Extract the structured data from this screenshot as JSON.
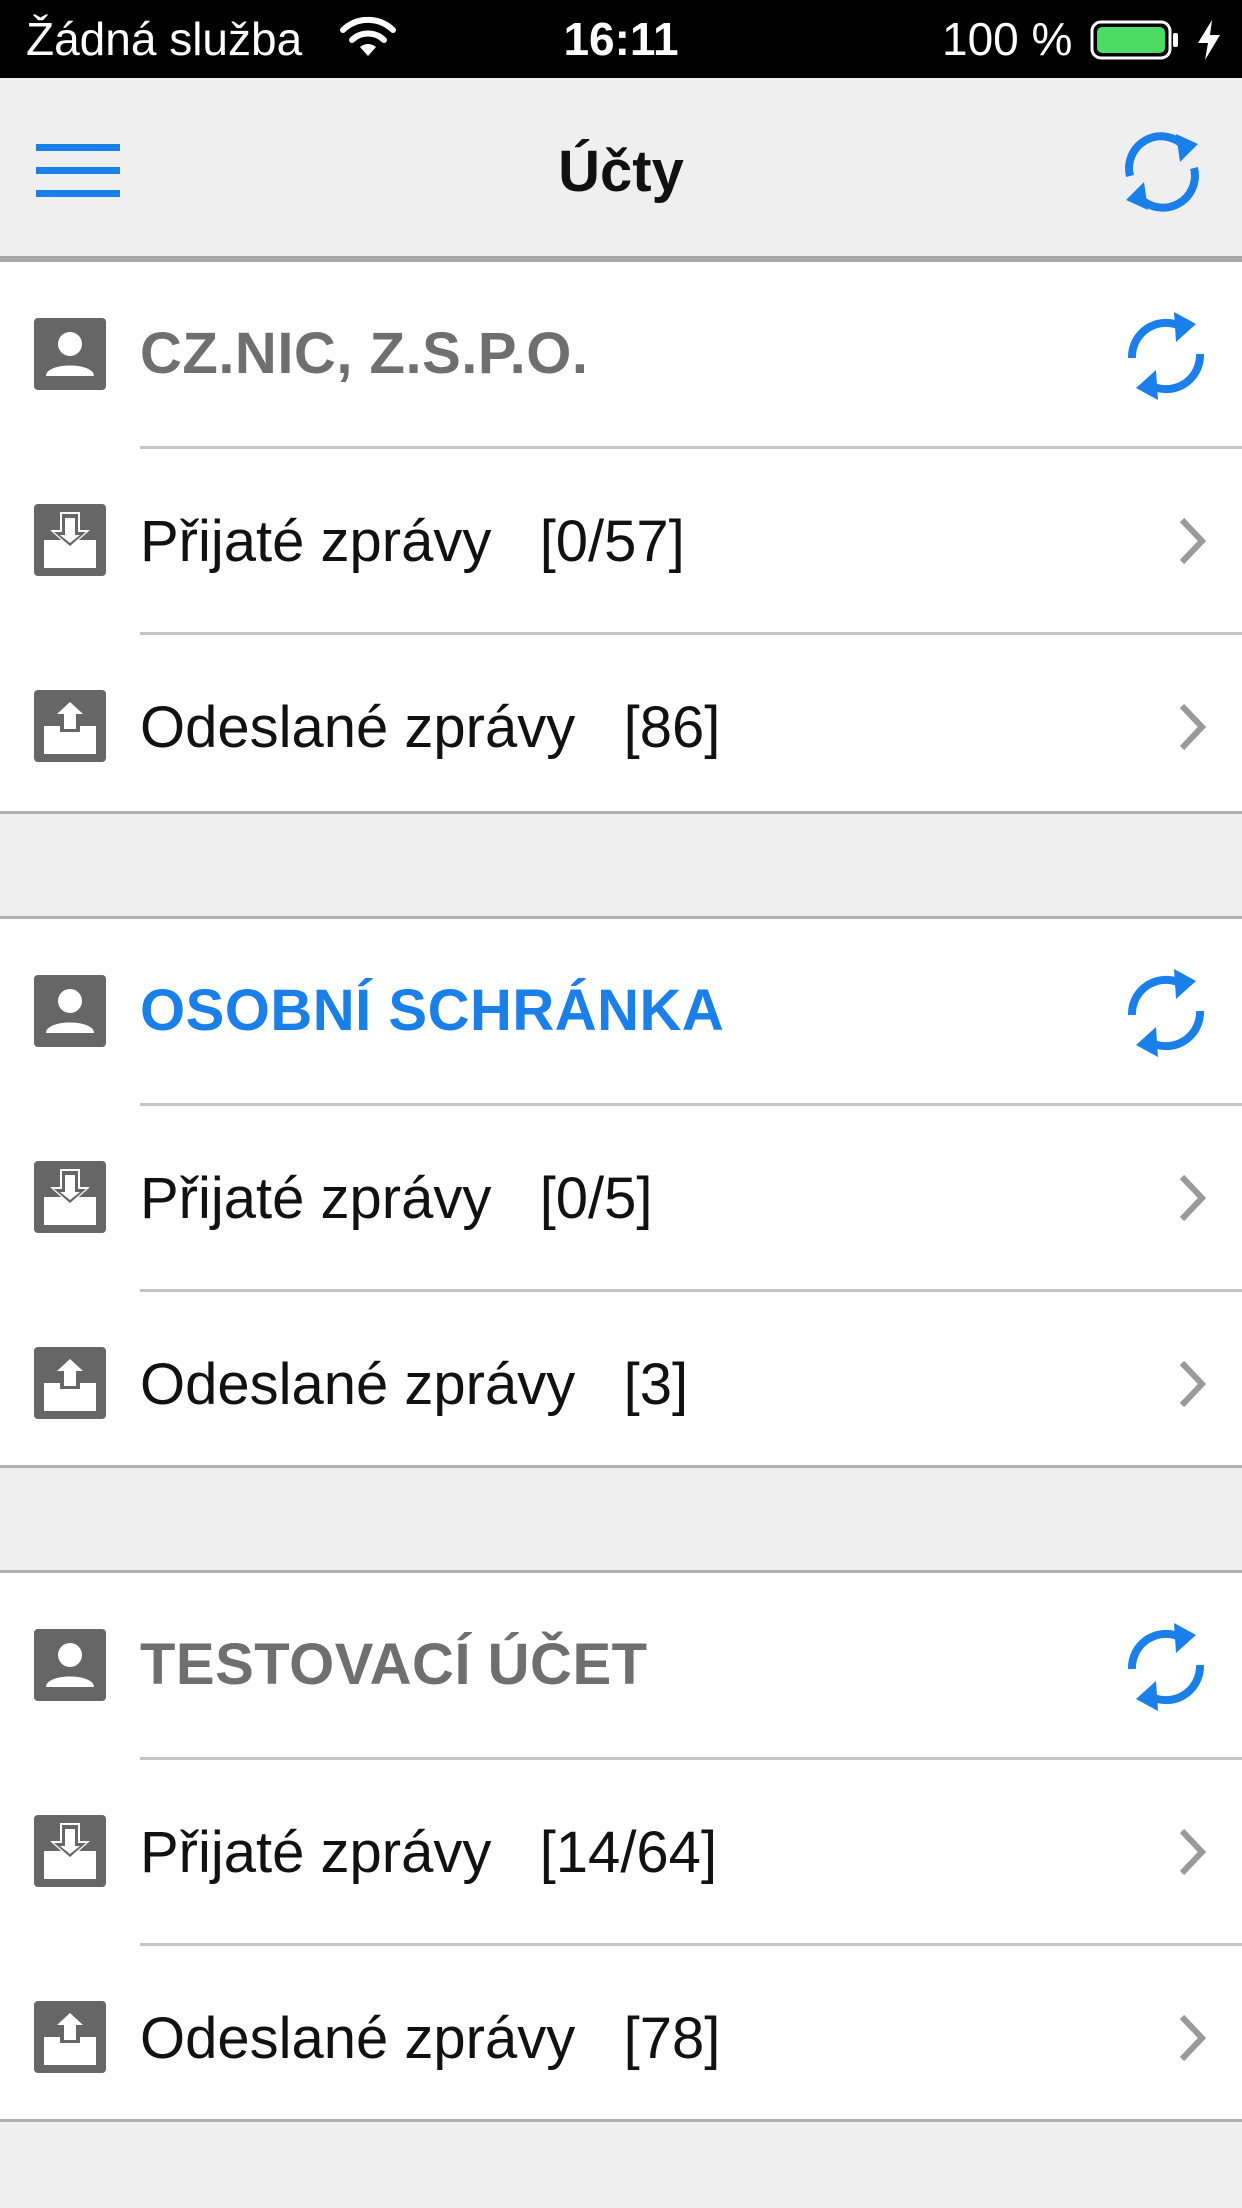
{
  "status_bar": {
    "carrier": "Žádná služba",
    "time": "16:11",
    "battery": "100 %"
  },
  "nav": {
    "title": "Účty",
    "accent_color": "#1a7fe8"
  },
  "accounts": [
    {
      "name": "CZ.NIC, Z.S.P.O.",
      "active": false,
      "received_label": "Přijaté zprávy",
      "received_count": "[0/57]",
      "sent_label": "Odeslané zprávy",
      "sent_count": "[86]"
    },
    {
      "name": "OSOBNÍ SCHRÁNKA",
      "active": true,
      "received_label": "Přijaté zprávy",
      "received_count": "[0/5]",
      "sent_label": "Odeslané zprávy",
      "sent_count": "[3]"
    },
    {
      "name": "TESTOVACÍ ÚČET",
      "active": false,
      "received_label": "Přijaté zprávy",
      "received_count": "[14/64]",
      "sent_label": "Odeslané zprávy",
      "sent_count": "[78]"
    }
  ],
  "icons": {
    "menu": "hamburger-menu-icon",
    "sync": "sync-icon",
    "account": "account-person-icon",
    "inbox": "inbox-download-icon",
    "outbox": "outbox-upload-icon",
    "chevron": "chevron-right-icon"
  }
}
